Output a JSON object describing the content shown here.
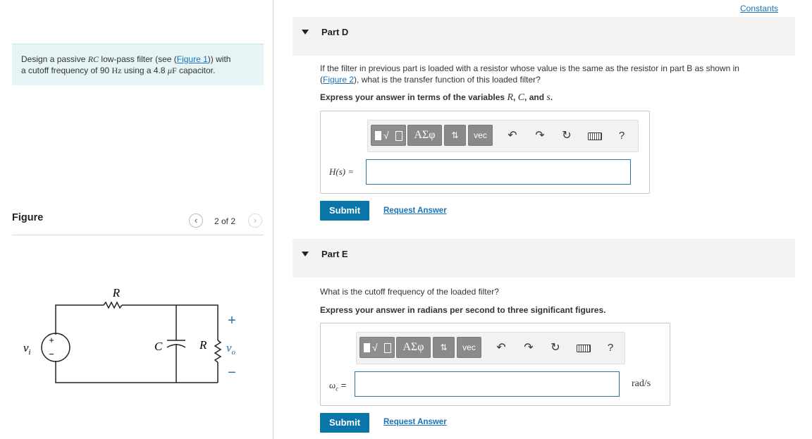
{
  "problem": {
    "text_1": "Design a passive ",
    "rc": "RC",
    "text_2": " low-pass filter (see (",
    "figure_link": "Figure 1",
    "text_3": ")) with",
    "text_4": "a cutoff frequency of 90 ",
    "hz": "Hz",
    "text_5": " using a 4.8 ",
    "mu": "μ",
    "farad": "F",
    "text_6": " capacitor."
  },
  "figure": {
    "title": "Figure",
    "counter": "2 of 2",
    "labels": {
      "R_top": "R",
      "C": "C",
      "R_load": "R",
      "vi": "v",
      "vi_sub": "i",
      "vo": "v",
      "vo_sub": "o",
      "plus": "+",
      "minus": "−",
      "src_plus": "+",
      "src_minus": "−"
    }
  },
  "constants_link": "Constants",
  "partD": {
    "title": "Part D",
    "question_1": "If the filter in previous part is loaded with a resistor whose value is the same as the resistor in part B as shown in",
    "question_2_pre": "(",
    "figure_link": "Figure 2",
    "question_2_post": "), what is the transfer function of this loaded filter?",
    "express_pre": "Express your answer in terms of the variables ",
    "var_R": "R",
    "sep1": ", ",
    "var_C": "C",
    "sep2": ", and ",
    "var_s": "s",
    "express_post": ".",
    "field_label": "H(s) =",
    "submit": "Submit",
    "request": "Request Answer"
  },
  "partE": {
    "title": "Part E",
    "question": "What is the cutoff frequency of the loaded filter?",
    "express": "Express your answer in radians per second to three significant figures.",
    "field_label_sym": "ω",
    "field_label_sub": "c",
    "field_label_eq": " =",
    "unit": "rad/s",
    "submit": "Submit",
    "request": "Request Answer"
  },
  "toolbar": {
    "greek": "ΑΣφ",
    "arrows": "⇅",
    "vec": "vec",
    "radical": "√",
    "help": "?",
    "icons": [
      "undo-icon",
      "redo-icon",
      "reset-icon",
      "keyboard-icon",
      "help-icon"
    ]
  }
}
